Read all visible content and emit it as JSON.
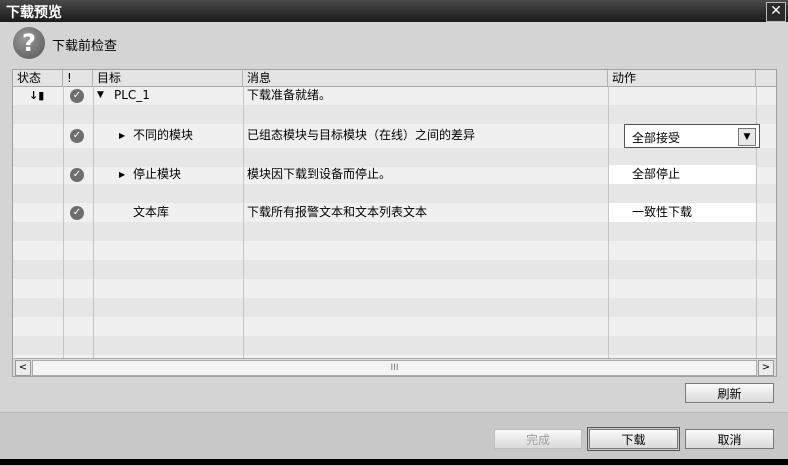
{
  "window": {
    "title": "下载预览",
    "close_glyph": "✕"
  },
  "header": {
    "icon": "question-icon",
    "icon_glyph": "?",
    "text": "下载前检查"
  },
  "grid": {
    "columns": {
      "status": "状态",
      "warn": "!",
      "target": "目标",
      "message": "消息",
      "action": "动作"
    },
    "rows": [
      {
        "status_icon": "download-status-icon",
        "status_glyph": "↓▮",
        "target": "PLC_1",
        "message": "下载准备就绪。",
        "action": ""
      },
      {
        "target": "不同的模块",
        "message": "已组态模块与目标模块（在线）之间的差异",
        "action": "全部接受"
      },
      {
        "target": "停止模块",
        "message": "模块因下载到设备而停止。",
        "action": "全部停止"
      },
      {
        "target": "文本库",
        "message": "下载所有报警文本和文本列表文本",
        "action": "一致性下载"
      }
    ],
    "scroll_left": "<",
    "scroll_right": ">",
    "scroll_thumb": "III"
  },
  "buttons": {
    "refresh": "刷新",
    "finish": "完成",
    "download": "下载",
    "cancel": "取消"
  }
}
